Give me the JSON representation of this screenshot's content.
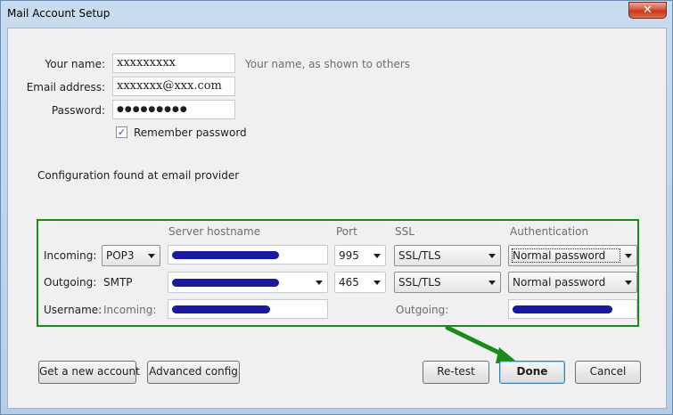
{
  "window": {
    "title": "Mail Account Setup",
    "close_glyph": "✕"
  },
  "form": {
    "name_label": "Your name:",
    "name_value": "xxxxxxxxx",
    "name_hint": "Your name, as shown to others",
    "email_label": "Email address:",
    "email_value": "xxxxxxx@xxx.com",
    "password_label": "Password:",
    "password_value": "●●●●●●●●●",
    "remember_label": "Remember password",
    "remember_checked": true
  },
  "status_text": "Configuration found at email provider",
  "config": {
    "headers": {
      "server_hostname": "Server hostname",
      "port": "Port",
      "ssl": "SSL",
      "authentication": "Authentication"
    },
    "incoming": {
      "label": "Incoming:",
      "protocol": "POP3",
      "port": "995",
      "ssl": "SSL/TLS",
      "auth": "Normal password"
    },
    "outgoing": {
      "label": "Outgoing:",
      "protocol": "SMTP",
      "port": "465",
      "ssl": "SSL/TLS",
      "auth": "Normal password"
    },
    "username": {
      "label": "Username:",
      "incoming_label": "Incoming:",
      "outgoing_label": "Outgoing:"
    }
  },
  "buttons": {
    "new_account": "Get a new account",
    "advanced": "Advanced config",
    "retest": "Re-test",
    "done": "Done",
    "cancel": "Cancel"
  },
  "colors": {
    "highlight_border": "#1a8a1a",
    "annotation_arrow": "#1a8a1a",
    "redaction": "#1a1aa0"
  }
}
